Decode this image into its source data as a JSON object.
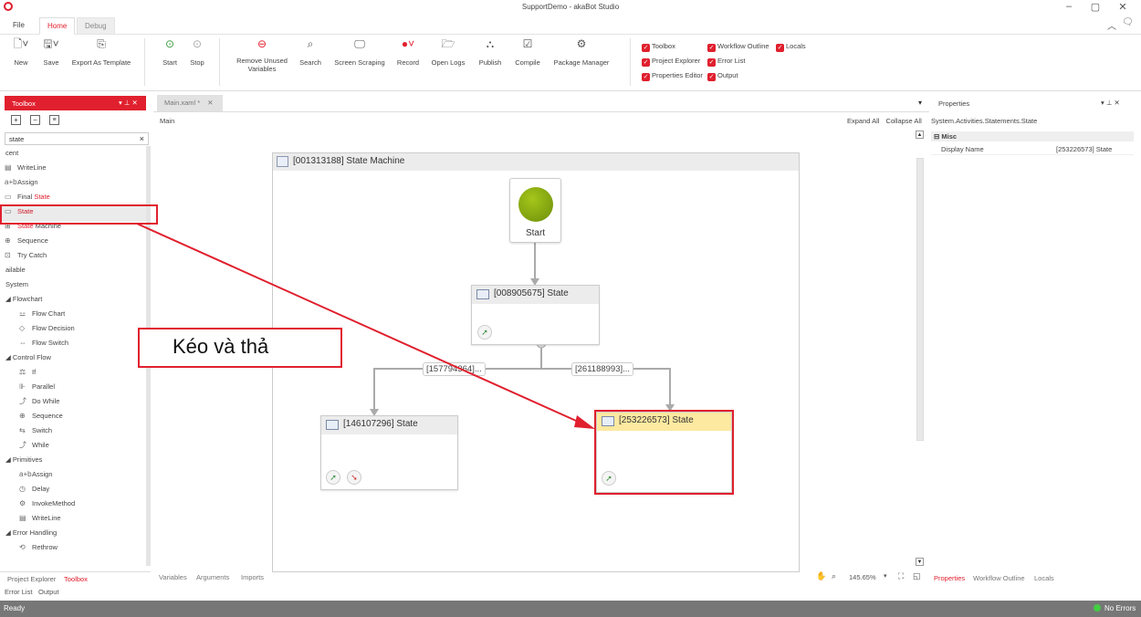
{
  "app": {
    "title": "SupportDemo - akaBot Studio"
  },
  "menu_tabs": {
    "file": "File",
    "home": "Home",
    "debug": "Debug"
  },
  "ribbon": {
    "new": "New",
    "save": "Save",
    "export": "Export As Template",
    "start": "Start",
    "stop": "Stop",
    "remove_unused_1": "Remove Unused",
    "remove_unused_2": "Variables",
    "search": "Search",
    "screen_scraping": "Screen Scraping",
    "record": "Record",
    "open_logs": "Open Logs",
    "publish": "Publish",
    "compile": "Compile",
    "package_manager": "Package Manager"
  },
  "panels_toggle": {
    "toolbox": "Toolbox",
    "project_explorer": "Project Explorer",
    "properties_editor": "Properties Editor",
    "workflow_outline": "Workflow Outline",
    "error_list": "Error List",
    "output": "Output",
    "locals": "Locals"
  },
  "toolbox": {
    "title": "Toolbox",
    "search_value": "state",
    "clear": "×",
    "group_recent": "cent",
    "group_available": "ailable",
    "group_system": "System",
    "group_flowchart": "Flowchart",
    "group_control_flow": "Control Flow",
    "group_primitives": "Primitives",
    "group_error_handling": "Error Handling",
    "recent_items": [
      {
        "pre": "WriteLine",
        "hl": "",
        "post": ""
      },
      {
        "pre": "Assign",
        "hl": "",
        "post": ""
      },
      {
        "pre": "Final ",
        "hl": "State",
        "post": ""
      },
      {
        "pre": "",
        "hl": "State",
        "post": ""
      },
      {
        "pre": "",
        "hl": "State",
        "post": " Machine"
      },
      {
        "pre": "Sequence",
        "hl": "",
        "post": ""
      },
      {
        "pre": "Try Catch",
        "hl": "",
        "post": ""
      }
    ],
    "flowchart_items": [
      "Flow Chart",
      "Flow Decision",
      "Flow Switch"
    ],
    "control_flow_items": [
      "If",
      "Parallel",
      "Do While",
      "Sequence",
      "Switch",
      "While"
    ],
    "primitives_items": [
      "Assign",
      "Delay",
      "InvokeMethod",
      "WriteLine"
    ],
    "error_items": [
      "Rethrow"
    ]
  },
  "left_bottom": {
    "project_explorer": "Project Explorer",
    "toolbox": "Toolbox",
    "error_list": "Error List",
    "output": "Output"
  },
  "document": {
    "tab": "Main.xaml *",
    "breadcrumb": "Main",
    "expand_all": "Expand All",
    "collapse_all": "Collapse All",
    "bottom_tabs": {
      "variables": "Variables",
      "arguments": "Arguments",
      "imports": "Imports"
    },
    "zoom": "145.65%"
  },
  "workflow": {
    "state_machine": "[001313188] State Machine",
    "start": "Start",
    "state_top": "[008905675] State",
    "state_left": "[146107296] State",
    "state_right": "[253226573] State",
    "transition_left": "[157794364]...",
    "transition_right": "[261188993]..."
  },
  "annotation": {
    "text": "Kéo và thả"
  },
  "properties": {
    "title": "Properties",
    "type": "System.Activities.Statements.State",
    "group": "Misc",
    "row_name": "Display Name",
    "row_value": "[253226573] State",
    "bottom_tabs": {
      "properties": "Properties",
      "workflow_outline": "Workflow Outline",
      "locals": "Locals"
    }
  },
  "status": {
    "left": "Ready",
    "right": "No Errors"
  },
  "colors": {
    "accent": "#e0202e",
    "start_green": "#8aab12",
    "status_bar": "#777777",
    "highlight_state": "#fde9a0"
  }
}
